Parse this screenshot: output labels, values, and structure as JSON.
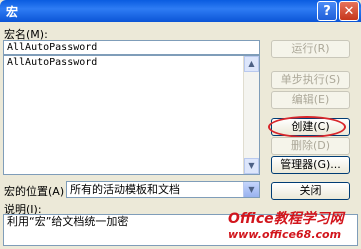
{
  "window": {
    "title": "宏",
    "help_glyph": "?",
    "close_glyph": "✕"
  },
  "macro_name": {
    "label": "宏名",
    "mnemonic": "(M):",
    "value": "AllAutoPassword"
  },
  "macro_list": {
    "items": [
      "AllAutoPassword"
    ]
  },
  "buttons": {
    "run": "运行(R)",
    "step": "单步执行(S)",
    "edit": "编辑(E)",
    "create": "创建(C)",
    "delete": "删除(D)",
    "organizer": "管理器(G)...",
    "close": "关闭"
  },
  "location": {
    "label": "宏的位置",
    "mnemonic": "(A)",
    "selected": "所有的活动模板和文档"
  },
  "description": {
    "label": "说明",
    "mnemonic": "(I):",
    "text": "利用“宏”给文档统一加密"
  },
  "watermark": {
    "brand": "Office教程学习网",
    "url": "www.office68.com"
  },
  "colors": {
    "title_bar": "#0A5CE0",
    "highlight": "#D8262B",
    "dialog_bg": "#ECE9D8"
  }
}
